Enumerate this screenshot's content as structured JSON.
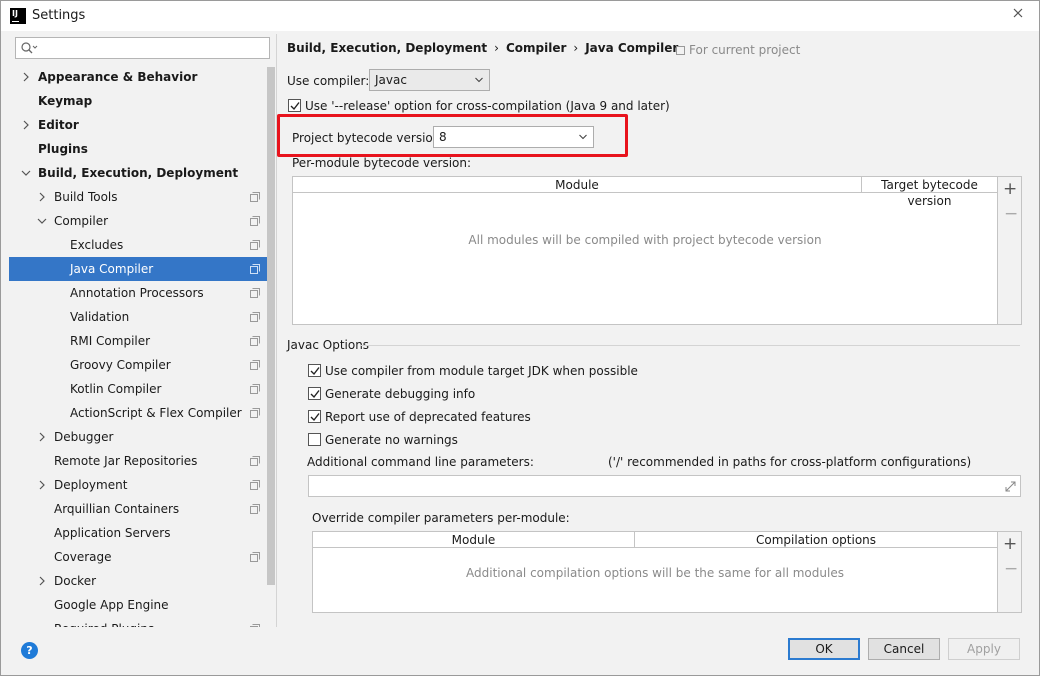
{
  "window": {
    "title": "Settings",
    "app_icon_text": "IJ"
  },
  "search": {
    "placeholder": ""
  },
  "sidebar": {
    "items": [
      {
        "label": "Appearance & Behavior",
        "bold": true,
        "expandable": true,
        "expanded": false
      },
      {
        "label": "Keymap",
        "bold": true
      },
      {
        "label": "Editor",
        "bold": true,
        "expandable": true,
        "expanded": false
      },
      {
        "label": "Plugins",
        "bold": true
      },
      {
        "label": "Build, Execution, Deployment",
        "bold": true,
        "expandable": true,
        "expanded": true
      },
      {
        "label": "Build Tools",
        "expandable": true,
        "expanded": false,
        "project_icon": true
      },
      {
        "label": "Compiler",
        "expandable": true,
        "expanded": true,
        "project_icon": true
      },
      {
        "label": "Excludes",
        "project_icon": true
      },
      {
        "label": "Java Compiler",
        "selected": true,
        "project_icon": true
      },
      {
        "label": "Annotation Processors",
        "project_icon": true
      },
      {
        "label": "Validation",
        "project_icon": true
      },
      {
        "label": "RMI Compiler",
        "project_icon": true
      },
      {
        "label": "Groovy Compiler",
        "project_icon": true
      },
      {
        "label": "Kotlin Compiler",
        "project_icon": true
      },
      {
        "label": "ActionScript & Flex Compiler",
        "project_icon": true
      },
      {
        "label": "Debugger",
        "expandable": true,
        "expanded": false
      },
      {
        "label": "Remote Jar Repositories",
        "project_icon": true
      },
      {
        "label": "Deployment",
        "expandable": true,
        "expanded": false,
        "project_icon": true
      },
      {
        "label": "Arquillian Containers",
        "project_icon": true
      },
      {
        "label": "Application Servers"
      },
      {
        "label": "Coverage",
        "project_icon": true
      },
      {
        "label": "Docker",
        "expandable": true,
        "expanded": false
      },
      {
        "label": "Google App Engine"
      },
      {
        "label": "Required Plugins",
        "project_icon": true
      }
    ]
  },
  "breadcrumb": {
    "part1": "Build, Execution, Deployment",
    "sep1": "›",
    "part2": "Compiler",
    "sep2": "›",
    "part3": "Java Compiler"
  },
  "for_current_project": "For current project",
  "use_compiler": {
    "label": "Use compiler:",
    "value": "Javac"
  },
  "release_option": {
    "label": "Use '--release' option for cross-compilation (Java 9 and later)",
    "checked": true
  },
  "bytecode_version": {
    "label": "Project bytecode version:",
    "value": "8"
  },
  "per_module": {
    "label": "Per-module bytecode version:",
    "col_module": "Module",
    "col_target": "Target bytecode version",
    "empty_text": "All modules will be compiled with project bytecode version"
  },
  "javac_options": {
    "title": "Javac Options",
    "checkboxes": [
      {
        "label": "Use compiler from module target JDK when possible",
        "checked": true
      },
      {
        "label": "Generate debugging info",
        "checked": true
      },
      {
        "label": "Report use of deprecated features",
        "checked": true
      },
      {
        "label": "Generate no warnings",
        "checked": false
      }
    ],
    "additional_params_label": "Additional command line parameters:",
    "additional_params_hint": "('/' recommended in paths for cross-platform configurations)",
    "additional_params_value": "",
    "override_label": "Override compiler parameters per-module:",
    "col_module": "Module",
    "col_options": "Compilation options",
    "override_empty": "Additional compilation options will be the same for all modules"
  },
  "buttons": {
    "ok": "OK",
    "cancel": "Cancel",
    "apply": "Apply",
    "help": "?"
  },
  "table_tools": {
    "add": "+",
    "remove": "−"
  },
  "colors": {
    "selection": "#3476c7",
    "highlight": "#e8131d",
    "ok_border": "#2c7bd0"
  }
}
